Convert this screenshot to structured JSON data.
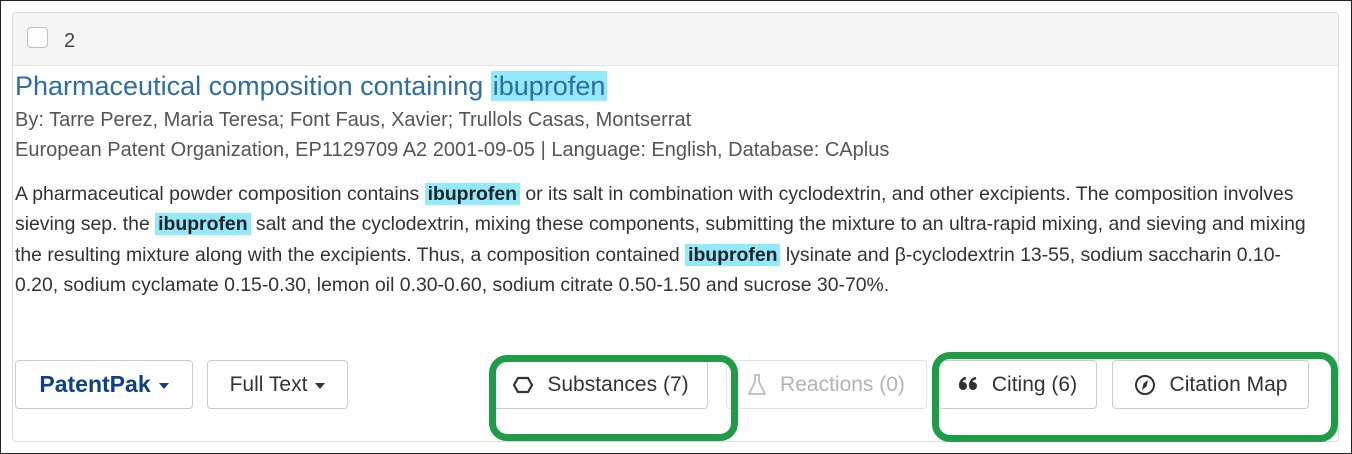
{
  "result": {
    "number": "2",
    "title_prefix": "Pharmaceutical composition containing ",
    "title_highlight": "ibuprofen",
    "authors": "By: Tarre Perez, Maria Teresa; Font Faus, Xavier; Trullols Casas, Montserrat",
    "publication": "European Patent Organization, EP1129709 A2 2001-09-05 | Language: English, Database: CAplus",
    "abstract": {
      "part1": "A pharmaceutical powder composition contains ",
      "hl1": "ibuprofen",
      "part2": " or its salt in combination with cyclodextrin, and other excipients. The composition involves sieving sep. the ",
      "hl2": "ibuprofen",
      "part3": " salt and the cyclodextrin, mixing these components, submitting the mixture to an ultra-rapid mixing, and sieving and mixing the resulting mixture along with the excipients. Thus, a composition contained ",
      "hl3": "ibuprofen",
      "part4": " lysinate and β-cyclodextrin 13-55, sodium saccharin 0.10-0.20, sodium cyclamate 0.15-0.30, lemon oil 0.30-0.60, sodium citrate 0.50-1.50 and sucrose 30-70%."
    }
  },
  "actions": {
    "patentpak": "PatentPak",
    "full_text": "Full Text",
    "substances": "Substances (7)",
    "reactions": "Reactions (0)",
    "citing": "Citing (6)",
    "citation_map": "Citation Map"
  },
  "icons": {
    "substances": "hexagon-icon",
    "reactions": "flask-icon",
    "citing": "quote-icon",
    "citation_map": "compass-icon"
  },
  "colors": {
    "title_link": "#2e6da4",
    "highlight": "#92e9fb",
    "patentpak": "#0e3f8a",
    "annotation_box": "#1e9c48"
  }
}
